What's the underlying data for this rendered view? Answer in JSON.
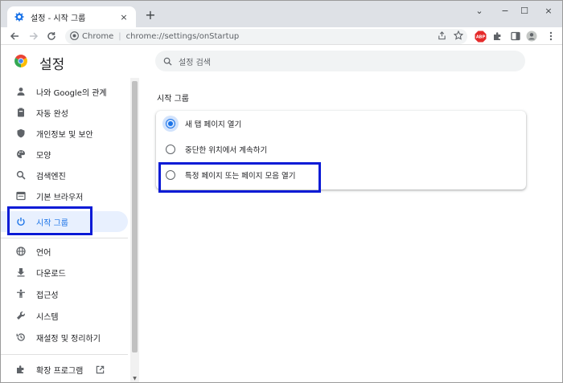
{
  "tab": {
    "title": "설정 - 시작 그룹",
    "close": "×",
    "new_tab": "+"
  },
  "window_controls": {
    "minimize": "−",
    "maximize": "☐",
    "close": "×",
    "dropdown": "⌄"
  },
  "toolbar": {
    "brand": "Chrome",
    "url": "chrome://settings/onStartup",
    "abp_label": "ABP"
  },
  "settings": {
    "title": "설정",
    "search_placeholder": "설정 검색"
  },
  "sidebar": {
    "items": [
      {
        "label": "나와 Google의 관계",
        "icon": "person-icon"
      },
      {
        "label": "자동 완성",
        "icon": "clipboard-icon"
      },
      {
        "label": "개인정보 및 보안",
        "icon": "shield-icon"
      },
      {
        "label": "모양",
        "icon": "palette-icon"
      },
      {
        "label": "검색엔진",
        "icon": "search-icon"
      },
      {
        "label": "기본 브라우저",
        "icon": "browser-icon"
      },
      {
        "label": "시작 그룹",
        "icon": "power-icon",
        "active": true
      },
      {
        "label": "언어",
        "icon": "globe-icon"
      },
      {
        "label": "다운로드",
        "icon": "download-icon"
      },
      {
        "label": "접근성",
        "icon": "accessibility-icon"
      },
      {
        "label": "시스템",
        "icon": "wrench-icon"
      },
      {
        "label": "재설정 및 정리하기",
        "icon": "history-icon"
      },
      {
        "label": "확장 프로그램",
        "icon": "puzzle-icon"
      }
    ]
  },
  "main": {
    "section_title": "시작 그룹",
    "options": [
      {
        "label": "새 탭 페이지 열기",
        "checked": true
      },
      {
        "label": "중단한 위치에서 계속하기",
        "checked": false
      },
      {
        "label": "특정 페이지 또는 페이지 모음 열기",
        "checked": false
      }
    ]
  },
  "colors": {
    "accent": "#1a73e8",
    "highlight_box": "#0b1bd6",
    "active_bg": "#e8f0fe"
  }
}
